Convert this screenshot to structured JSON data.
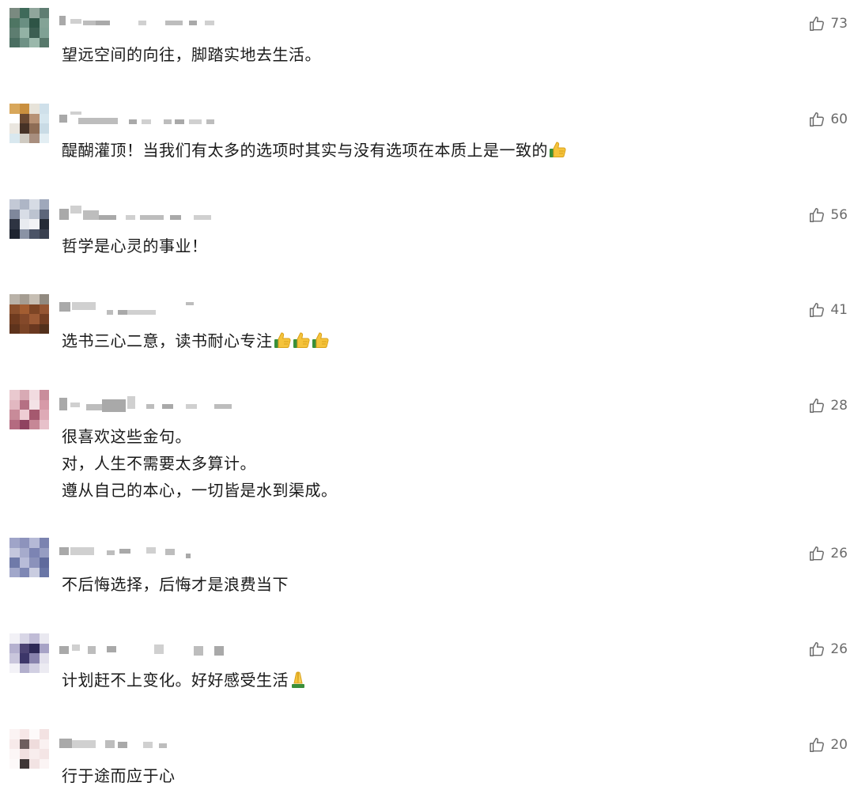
{
  "comments": [
    {
      "lines": [
        "望远空间的向往，脚踏实地去生活。"
      ],
      "likes": "73",
      "emoji": "",
      "avatar_colors": [
        "#7a8a80",
        "#3f6a5a",
        "#8fa59b",
        "#5f7d72",
        "#4e7563",
        "#6a8f82",
        "#2e5446",
        "#83a396",
        "#5d7d70",
        "#93b2a5",
        "#3c5e52",
        "#7fa194",
        "#4a6e61",
        "#6e9185",
        "#9ab8ab",
        "#57786b"
      ]
    },
    {
      "lines": [
        "醍醐灌顶！当我们有太多的选项时其实与没有选项在本质上是一致的"
      ],
      "likes": "60",
      "emoji": "thumbs-up",
      "emoji_count": 1,
      "avatar_colors": [
        "#d8a75b",
        "#c98f3e",
        "#e7e3d9",
        "#cfe0ea",
        "#ffffff",
        "#6b4a33",
        "#b79275",
        "#d6e6ee",
        "#eae6df",
        "#463226",
        "#8e6d55",
        "#c9dbe5",
        "#d9e8ef",
        "#cfcac1",
        "#a88e7e",
        "#e3eef3"
      ]
    },
    {
      "lines": [
        "哲学是心灵的事业！"
      ],
      "likes": "56",
      "emoji": "",
      "avatar_colors": [
        "#c3c9d6",
        "#aeb6c6",
        "#d6dbe4",
        "#9fa8bb",
        "#7f889c",
        "#d8dde6",
        "#bcc3d0",
        "#5c667a",
        "#2e3442",
        "#e8ebf0",
        "#f2f3f6",
        "#252b37",
        "#1e2430",
        "#8a93a5",
        "#4a5366",
        "#39404f"
      ]
    },
    {
      "lines": [
        "选书三心二意，读书耐心专注"
      ],
      "likes": "41",
      "emoji": "thumbs-up",
      "emoji_count": 3,
      "avatar_colors": [
        "#b9b2a8",
        "#a59d92",
        "#c6beb3",
        "#918a80",
        "#8a4f2c",
        "#a35d31",
        "#7d4525",
        "#955532",
        "#6f3b1f",
        "#84492a",
        "#9c5a35",
        "#743e22",
        "#5e331c",
        "#7b4426",
        "#6a3820",
        "#52301b"
      ]
    },
    {
      "lines": [
        "很喜欢这些金句。",
        "对，人生不需要太多算计。",
        "遵从自己的本心，一切皆是水到渠成。"
      ],
      "likes": "28",
      "emoji": "",
      "avatar_colors": [
        "#e9c9cf",
        "#d8aab4",
        "#f1dbe0",
        "#c98d9b",
        "#e2b8c1",
        "#b57083",
        "#f3e2e6",
        "#d79aa8",
        "#c88b99",
        "#eecdd4",
        "#a5596f",
        "#deaab6",
        "#b46b80",
        "#8f4360",
        "#c68796",
        "#e7c1ca"
      ]
    },
    {
      "lines": [
        "不后悔选择，后悔才是浪费当下"
      ],
      "likes": "26",
      "emoji": "",
      "avatar_colors": [
        "#9fa4c8",
        "#8d93bc",
        "#b5b9d6",
        "#7b83b0",
        "#c4c7dd",
        "#a6abcc",
        "#7c84b3",
        "#969dc2",
        "#6f7aa9",
        "#b8bcd8",
        "#8b92bb",
        "#5f6a9c",
        "#a1a7ca",
        "#7e87b4",
        "#c9cce0",
        "#6a76a6"
      ]
    },
    {
      "lines": [
        "计划赶不上变化。好好感受生活"
      ],
      "likes": "26",
      "emoji": "folded-hands",
      "emoji_count": 1,
      "avatar_colors": [
        "#f2f1f6",
        "#d8d6e6",
        "#c0bcd6",
        "#e9e8f0",
        "#b5b1cf",
        "#4c4474",
        "#2d2956",
        "#a7a3c6",
        "#c9c6dc",
        "#3c3669",
        "#8883ad",
        "#e2e0ec",
        "#f3f2f7",
        "#b2afcc",
        "#d1cfe2",
        "#ecebf2"
      ]
    },
    {
      "lines": [
        "行于途而应于心"
      ],
      "likes": "20",
      "emoji": "",
      "avatar_colors": [
        "#fbf3f3",
        "#f6e7e7",
        "#fdfafa",
        "#f3e2e2",
        "#f7eaea",
        "#6e5e5e",
        "#efdcdc",
        "#faf1f1",
        "#fcf6f6",
        "#f1e0e0",
        "#f8eded",
        "#f4e5e5",
        "#fdf9f9",
        "#3f3636",
        "#f2e3e3",
        "#fbf4f4"
      ]
    }
  ]
}
